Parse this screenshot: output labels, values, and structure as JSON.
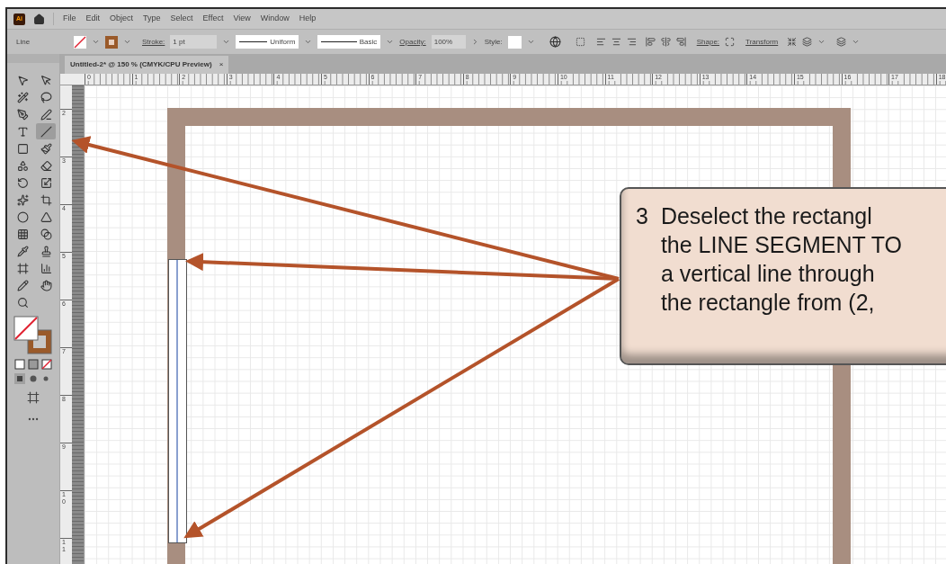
{
  "app": {
    "logo": "Ai"
  },
  "menu": [
    "File",
    "Edit",
    "Object",
    "Type",
    "Select",
    "Effect",
    "View",
    "Window",
    "Help"
  ],
  "control_bar": {
    "tool_name": "Line",
    "stroke_label": "Stroke:",
    "stroke_weight": "1 pt",
    "profile": "Uniform",
    "brush": "Basic",
    "opacity_label": "Opacity:",
    "opacity": "100%",
    "style_label": "Style:",
    "shape_label": "Shape:",
    "transform": "Transform"
  },
  "document_tab": {
    "title": "Untitled-2* @ 150 % (CMYK/CPU Preview)",
    "close": "×"
  },
  "rulers": {
    "horizontal": [
      "0",
      "1",
      "2",
      "3",
      "4",
      "5",
      "6",
      "7",
      "8",
      "9",
      "10",
      "11",
      "12",
      "13",
      "14",
      "15",
      "16",
      "17",
      "18"
    ],
    "vertical": [
      "2",
      "3",
      "4",
      "5",
      "6",
      "7",
      "8",
      "9",
      "10",
      "11"
    ]
  },
  "tools": [
    {
      "selected": false
    },
    {
      "selected": false
    },
    {
      "selected": false
    },
    {
      "selected": false
    },
    {
      "selected": false
    },
    {
      "selected": false
    },
    {
      "selected": false
    },
    {
      "selected": true
    },
    {
      "selected": false
    },
    {
      "selected": false
    },
    {
      "selected": false
    },
    {
      "selected": false
    },
    {
      "selected": false
    },
    {
      "selected": false
    },
    {
      "selected": false
    },
    {
      "selected": false
    },
    {
      "selected": false
    },
    {
      "selected": false
    },
    {
      "selected": false
    },
    {
      "selected": false
    },
    {
      "selected": false
    },
    {
      "selected": false
    },
    {
      "selected": false
    },
    {
      "selected": false
    },
    {
      "selected": false
    },
    {
      "selected": false
    },
    {
      "selected": false
    }
  ],
  "callout": {
    "number": "3",
    "lines": [
      "Deselect the rectangl",
      "the LINE SEGMENT TO",
      "a vertical line through",
      "the rectangle from (2,"
    ]
  }
}
